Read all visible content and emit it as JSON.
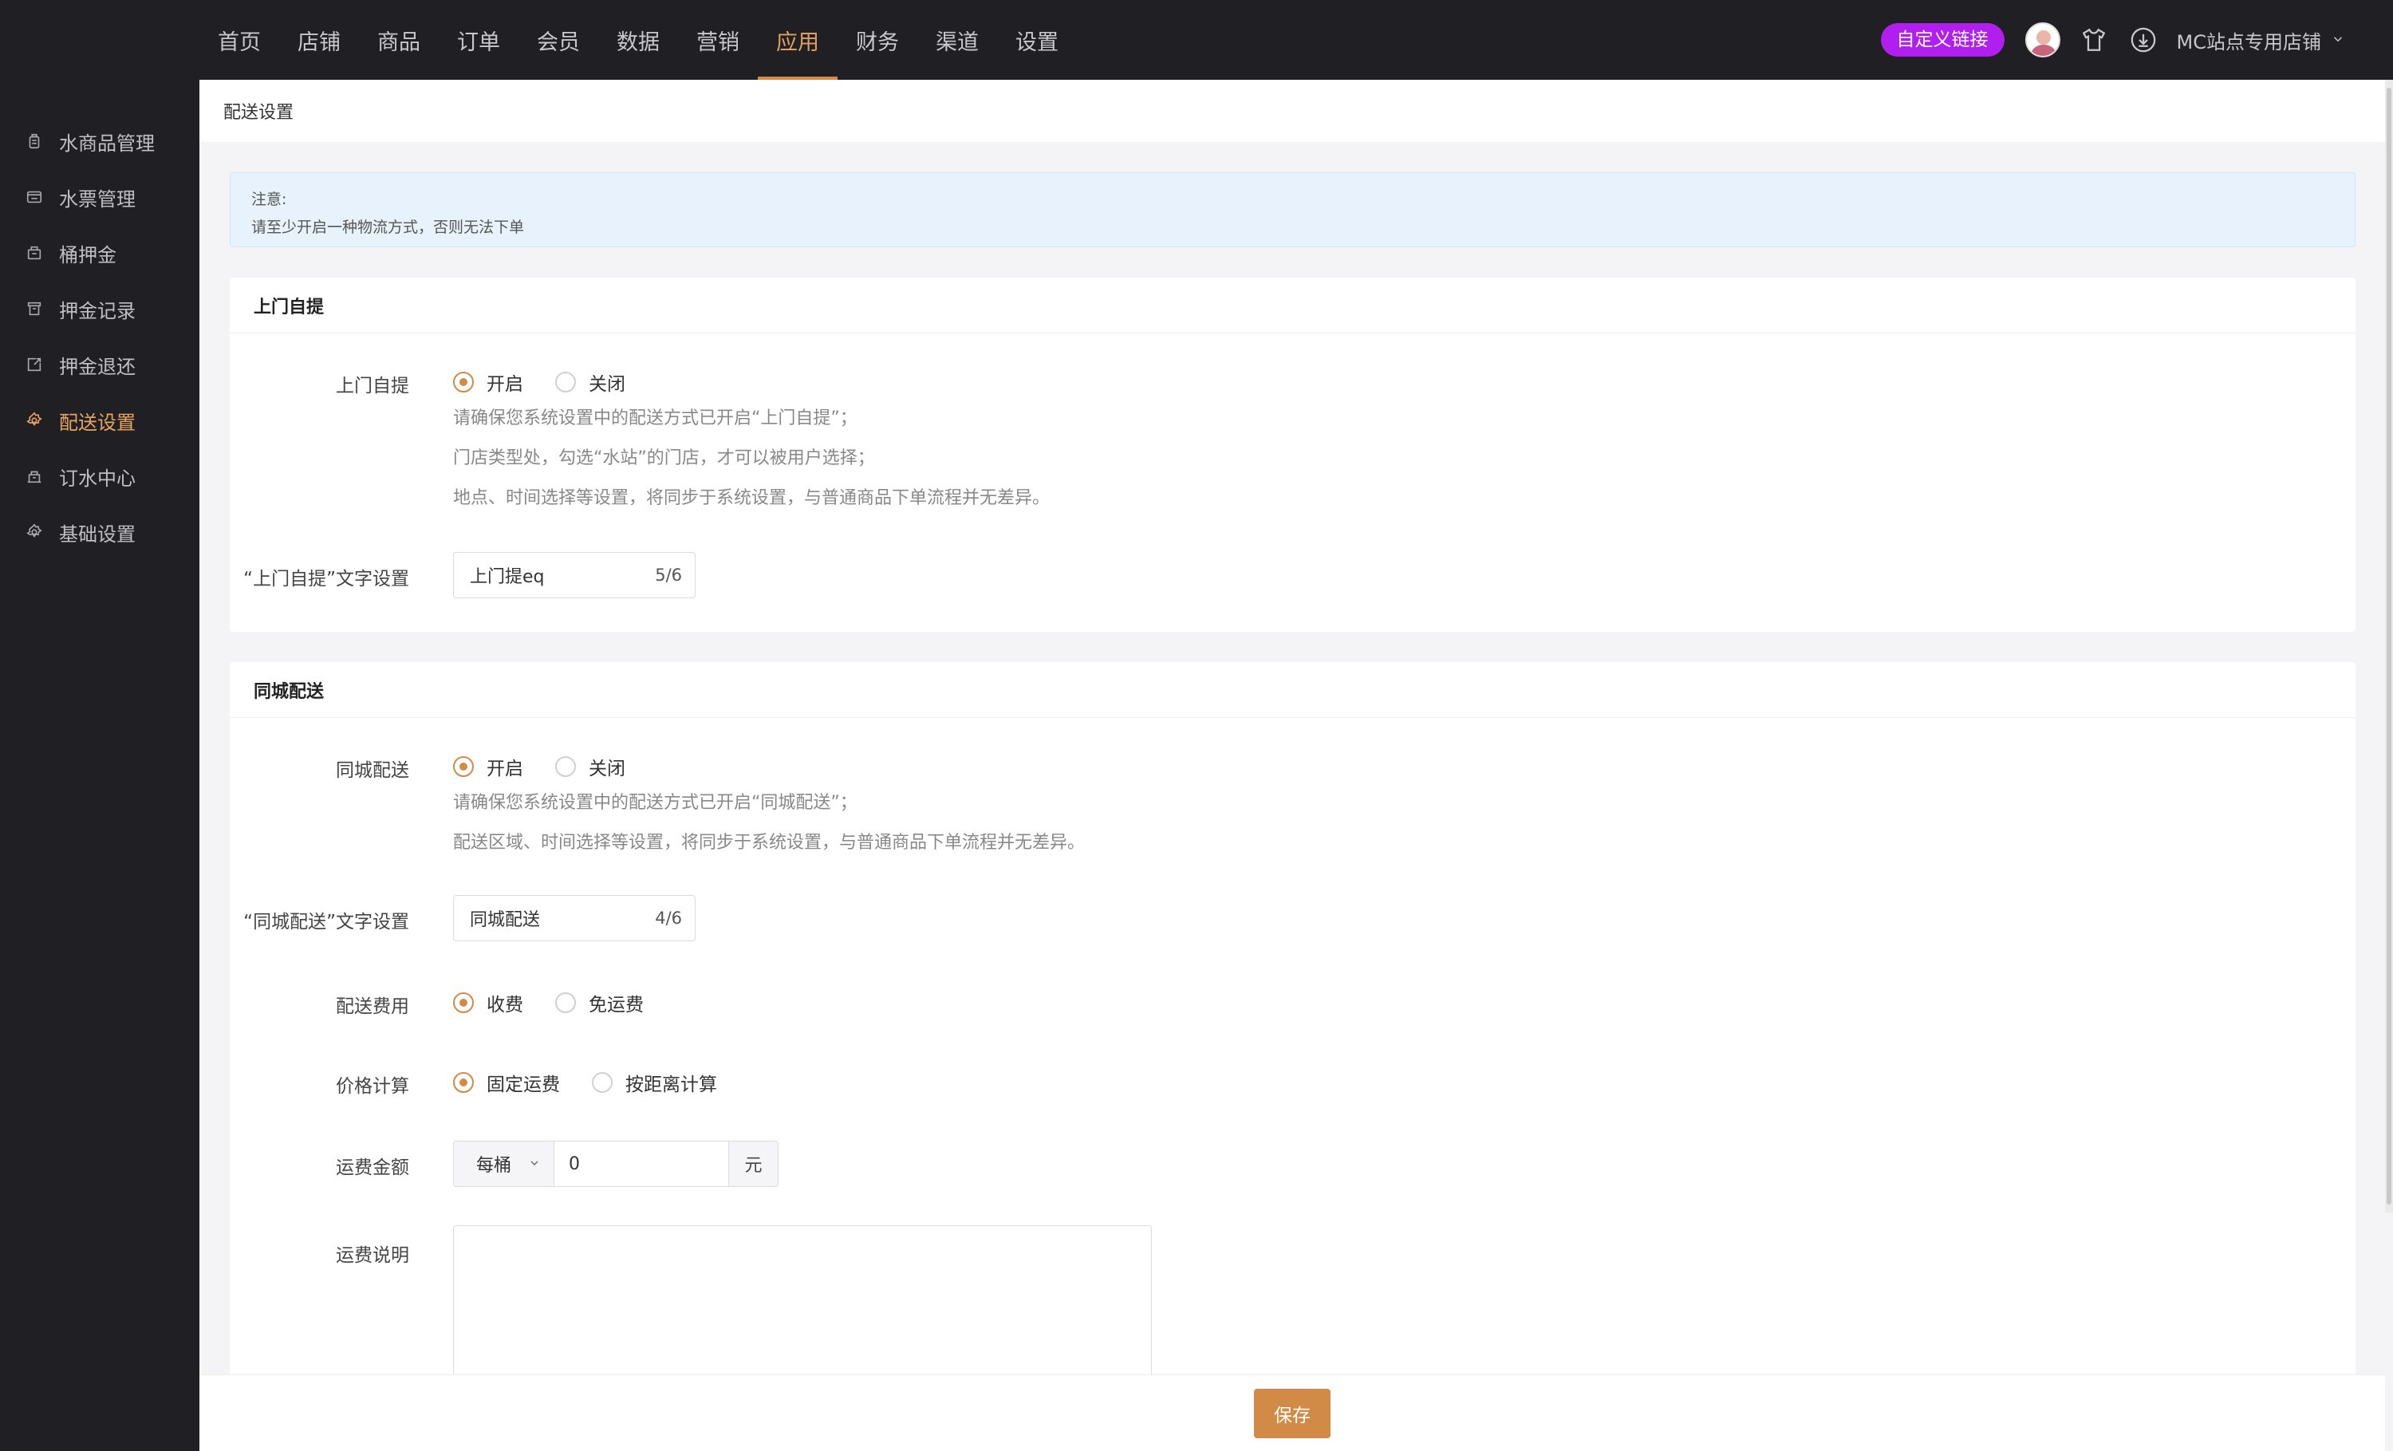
{
  "topnav": {
    "items": [
      {
        "label": "首页"
      },
      {
        "label": "店铺"
      },
      {
        "label": "商品"
      },
      {
        "label": "订单"
      },
      {
        "label": "会员"
      },
      {
        "label": "数据"
      },
      {
        "label": "营销"
      },
      {
        "label": "应用"
      },
      {
        "label": "财务"
      },
      {
        "label": "渠道"
      },
      {
        "label": "设置"
      }
    ],
    "active": "应用",
    "custom_link_label": "自定义链接",
    "store_name": "MC站点专用店铺"
  },
  "sidebar": {
    "items": [
      {
        "label": "水商品管理",
        "icon": "bottle-icon"
      },
      {
        "label": "水票管理",
        "icon": "ticket-icon"
      },
      {
        "label": "桶押金",
        "icon": "bucket-icon"
      },
      {
        "label": "押金记录",
        "icon": "record-icon"
      },
      {
        "label": "押金退还",
        "icon": "refund-icon"
      },
      {
        "label": "配送设置",
        "icon": "gear-icon"
      },
      {
        "label": "订水中心",
        "icon": "center-icon"
      },
      {
        "label": "基础设置",
        "icon": "gear-icon"
      }
    ],
    "active": "配送设置"
  },
  "page": {
    "title": "配送设置"
  },
  "notice": {
    "title": "注意:",
    "text": "请至少开启一种物流方式，否则无法下单"
  },
  "pickup": {
    "section_title": "上门自提",
    "toggle_label": "上门自提",
    "on_label": "开启",
    "off_label": "关闭",
    "selected": "on",
    "hints": [
      "请确保您系统设置中的配送方式已开启“上门自提”；",
      "门店类型处，勾选“水站”的门店，才可以被用户选择；",
      "地点、时间选择等设置，将同步于系统设置，与普通商品下单流程并无差异。"
    ],
    "text_label": "“上门自提”文字设置",
    "text_value": "上门提eq",
    "text_count": "5/6"
  },
  "local": {
    "section_title": "同城配送",
    "toggle_label": "同城配送",
    "on_label": "开启",
    "off_label": "关闭",
    "selected": "on",
    "hints": [
      "请确保您系统设置中的配送方式已开启“同城配送”；",
      "配送区域、时间选择等设置，将同步于系统设置，与普通商品下单流程并无差异。"
    ],
    "text_label": "“同城配送”文字设置",
    "text_value": "同城配送",
    "text_count": "4/6",
    "fee_label": "配送费用",
    "fee_charge": "收费",
    "fee_free": "免运费",
    "price_label": "价格计算",
    "price_fixed": "固定运费",
    "price_distance": "按距离计算",
    "amount_label": "运费金额",
    "amount_unit_select": "每桶",
    "amount_value": "0",
    "amount_unit": "元",
    "desc_label": "运费说明"
  },
  "footer": {
    "save_label": "保存"
  },
  "colors": {
    "accent": "#d28b46",
    "custom_link": "#b11ff0",
    "dark_bg": "#1f1f24"
  }
}
